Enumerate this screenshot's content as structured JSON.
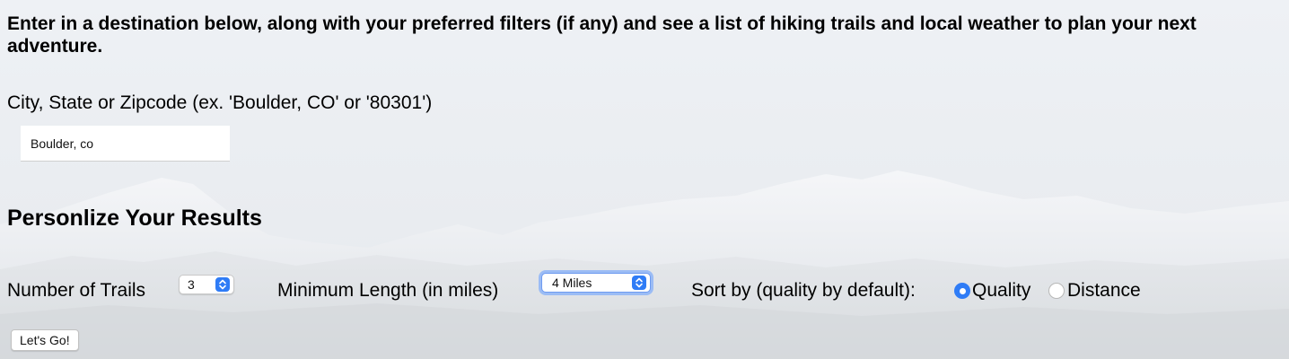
{
  "intro_text": "Enter in a destination below, along with your preferred filters (if any) and see a list of hiking trails and local weather to plan your next adventure.",
  "location": {
    "label": "City, State or Zipcode (ex. 'Boulder, CO' or '80301')",
    "value": "Boulder, co"
  },
  "personalize": {
    "title": "Personlize Your Results",
    "num_trails": {
      "label": "Number of Trails",
      "selected": "3"
    },
    "min_length": {
      "label": "Minimum Length (in miles)",
      "selected": "4 Miles"
    },
    "sort": {
      "label": "Sort by (quality by default):",
      "options": [
        "Quality",
        "Distance"
      ],
      "selected": "Quality"
    }
  },
  "submit_label": "Let's Go!",
  "colors": {
    "accent": "#2f7cf6",
    "focus_ring": "#9bbcf5"
  },
  "icons": {
    "select_arrows": "select-arrows-icon",
    "background": "mountain-background"
  }
}
